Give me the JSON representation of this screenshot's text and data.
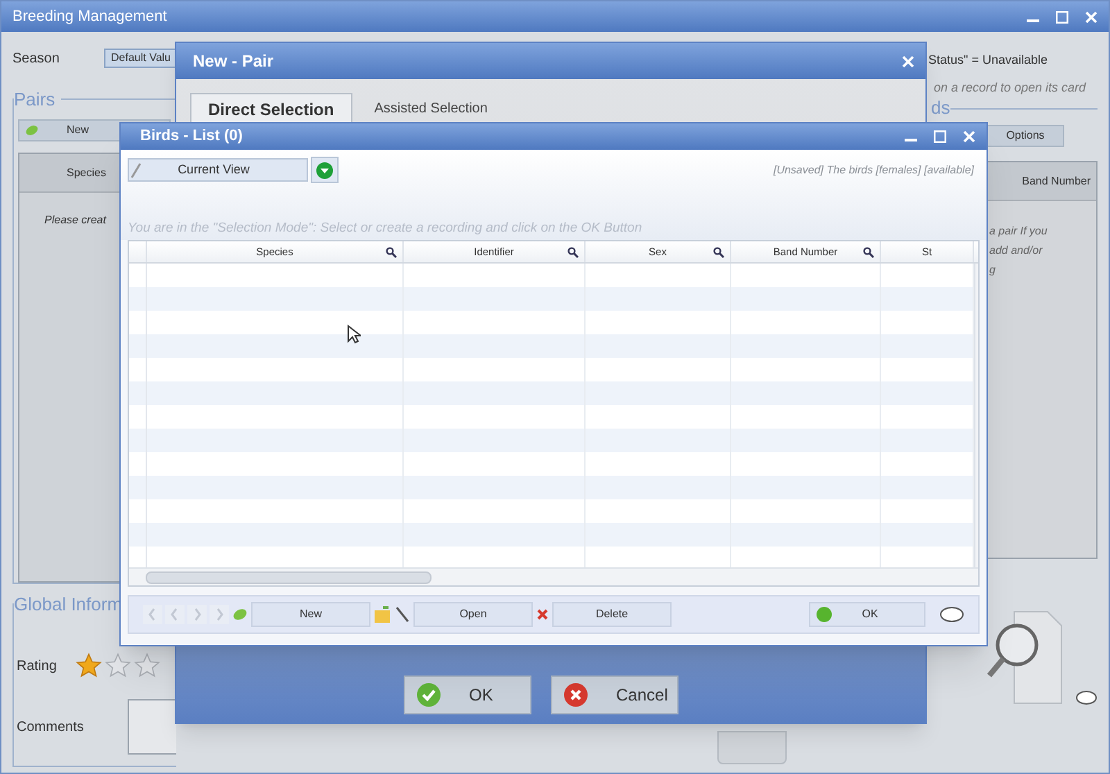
{
  "main_window": {
    "title": "Breeding Management",
    "season_label": "Season",
    "season_value": "Default Valu",
    "status_note": "Status\" = Unavailable",
    "hint": "on a record to open its card",
    "pairs": {
      "title": "Pairs",
      "new_button": "New",
      "columns": [
        "Species"
      ],
      "empty_text": "Please creat"
    },
    "birds": {
      "title": "ds",
      "options_button": "Options",
      "columns": [
        "Band Number"
      ],
      "empty_text_lines": [
        "a pair If you",
        "add and/or",
        "g"
      ]
    },
    "global_info": {
      "title": "Global Inform",
      "rating_label": "Rating",
      "stars": 1,
      "comments_label": "Comments"
    }
  },
  "new_pair": {
    "title": "New - Pair",
    "tabs": [
      {
        "label": "Direct Selection",
        "selected": true
      },
      {
        "label": "Assisted Selection",
        "selected": false
      }
    ],
    "buttons": [
      {
        "label": "OK",
        "kind": "ok"
      },
      {
        "label": "Cancel",
        "kind": "cancel"
      }
    ]
  },
  "birds_list": {
    "title": "Birds - List (0)",
    "view_button": "Current View",
    "filter_note": "[Unsaved] The birds [females] [available]",
    "hint": "You are in the \"Selection Mode\": Select or create a recording and click on the OK Button",
    "columns": [
      "Species",
      "Identifier",
      "Sex",
      "Band Number",
      "St"
    ],
    "toolbar": [
      {
        "label": "New",
        "kind": "new"
      },
      {
        "label": "Open",
        "kind": "open"
      },
      {
        "label": "Delete",
        "kind": "delete"
      }
    ],
    "ok_button": "OK"
  }
}
